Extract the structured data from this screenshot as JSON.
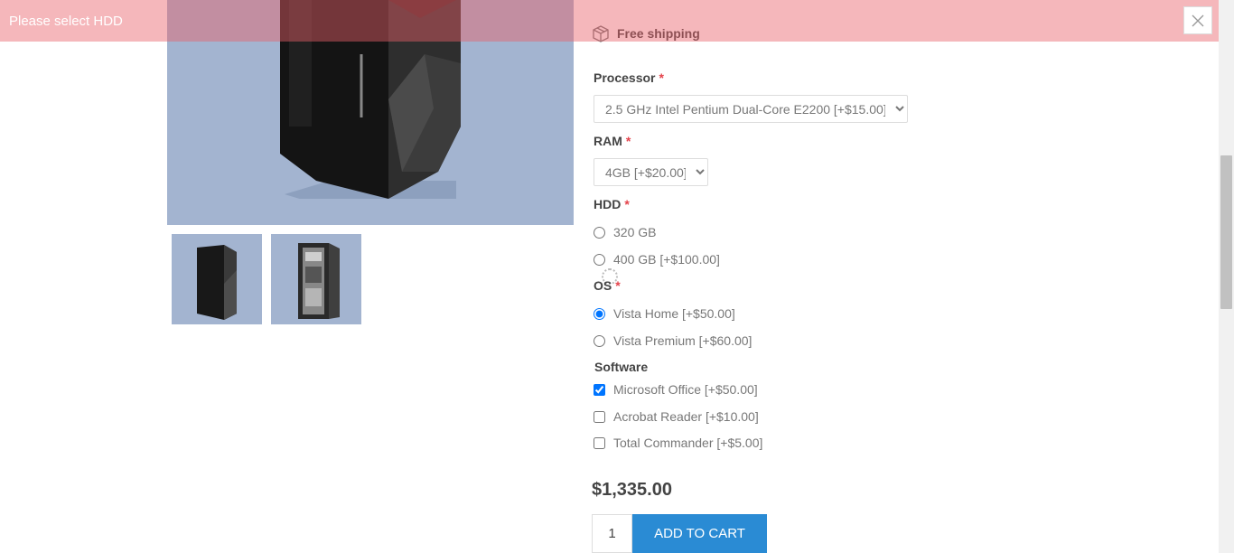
{
  "notification": {
    "text": "Please select HDD"
  },
  "shipping": {
    "label": "Free shipping",
    "icon": "box-icon"
  },
  "attributes": {
    "processor": {
      "label": "Processor",
      "required_mark": "*",
      "selected": "2.5 GHz Intel Pentium Dual-Core E2200 [+$15.00]"
    },
    "ram": {
      "label": "RAM",
      "required_mark": "*",
      "selected": "4GB [+$20.00]"
    },
    "hdd": {
      "label": "HDD",
      "required_mark": "*",
      "options": [
        "320 GB",
        "400 GB [+$100.00]"
      ]
    },
    "os": {
      "label": "OS",
      "required_mark": "*",
      "options": [
        "Vista Home [+$50.00]",
        "Vista Premium [+$60.00]"
      ],
      "selected_index": 0
    },
    "software": {
      "label": "Software",
      "options": [
        "Microsoft Office [+$50.00]",
        "Acrobat Reader [+$10.00]",
        "Total Commander [+$5.00]"
      ],
      "checked": [
        true,
        false,
        false
      ]
    }
  },
  "price": "$1,335.00",
  "cart": {
    "quantity": "1",
    "button_label": "ADD TO CART"
  },
  "colors": {
    "accent": "#2a8bd4",
    "required": "#e4434b",
    "notification_bg": "#f2b5b8",
    "image_bg": "#a3b4d0"
  }
}
